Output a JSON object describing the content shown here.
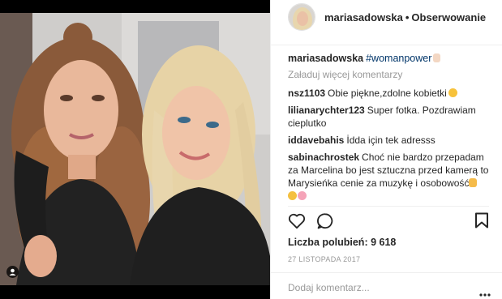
{
  "post": {
    "username": "mariasadowska",
    "separator": "•",
    "follow_label": "Obserwowanie",
    "caption_user": "mariasadowska",
    "caption_tag": "#womanpower",
    "load_more": "Załaduj więcej komentarzy",
    "comments": [
      {
        "user": "nsz1103",
        "text": "Obie piękne,zdolne kobietki"
      },
      {
        "user": "lilianarychter123",
        "text": "Super fotka. Pozdrawiam cieplutko"
      },
      {
        "user": "iddavebahis",
        "text": "İdda için tek adresss"
      },
      {
        "user": "sabinachrostek",
        "text": "Choć nie bardzo przepadam za Marcelina bo jest sztuczna przed kamerą to Marysieńka cenie za muzykę i osobowość"
      }
    ],
    "likes": "Liczba polubień: 9 618",
    "date": "27 LISTOPADA 2017",
    "add_comment_placeholder": "Dodaj komentarz..."
  },
  "icons": {
    "like": "heart-icon",
    "comment": "speech-bubble-icon",
    "save": "bookmark-icon",
    "more": "ellipsis-icon",
    "tagged": "user-tag-icon"
  },
  "colors": {
    "text": "#262626",
    "muted": "#999999",
    "hashtag": "#003569",
    "border": "#efefef"
  }
}
